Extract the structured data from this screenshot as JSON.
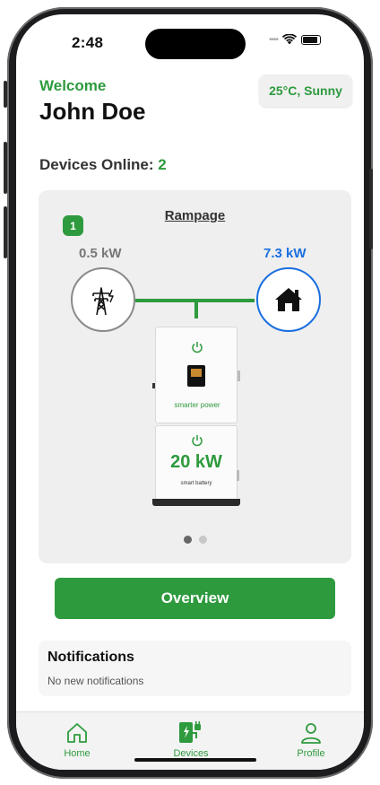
{
  "status_bar": {
    "time": "2:48"
  },
  "header": {
    "welcome": "Welcome",
    "user_name": "John Doe",
    "weather": "25°C, Sunny"
  },
  "devices": {
    "online_label": "Devices Online:",
    "online_count": "2"
  },
  "device_card": {
    "index_badge": "1",
    "title": "Rampage",
    "grid_power": "0.5 kW",
    "home_power": "7.3 kW",
    "inverter_brand": "smarter power",
    "battery_power": "20 kW",
    "battery_label": "smart battery",
    "pager": {
      "pages": 2,
      "active": 1
    }
  },
  "actions": {
    "overview_label": "Overview"
  },
  "notifications": {
    "title": "Notifications",
    "message": "No new notifications"
  },
  "tabbar": {
    "items": [
      {
        "label": "Home",
        "icon": "house-icon"
      },
      {
        "label": "Devices",
        "icon": "ev-charger-icon"
      },
      {
        "label": "Profile",
        "icon": "person-icon"
      }
    ]
  },
  "colors": {
    "accent": "#2e9a3e",
    "home_blue": "#1a6fe0",
    "grid_gray": "#777777",
    "card_bg": "#efefef"
  }
}
